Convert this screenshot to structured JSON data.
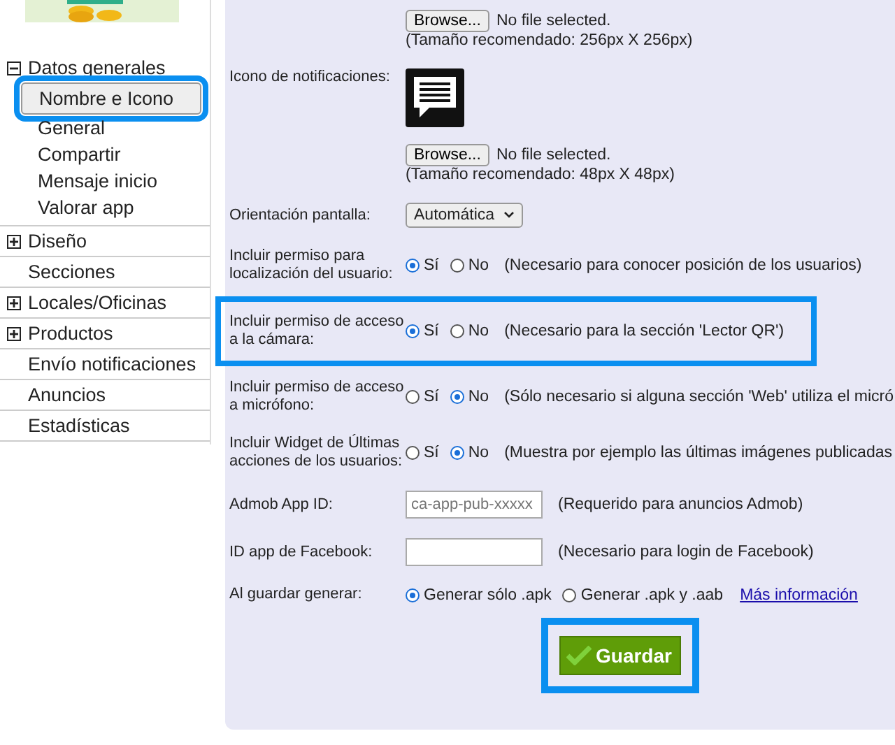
{
  "sidebar": {
    "items": [
      {
        "kind": "group",
        "label": "Datos generales",
        "expanded": true,
        "children": [
          {
            "label": "Nombre e Icono",
            "selected": true,
            "highlighted": true
          },
          {
            "label": "General",
            "selected": false,
            "highlighted": false
          },
          {
            "label": "Compartir",
            "selected": false,
            "highlighted": false
          },
          {
            "label": "Mensaje inicio",
            "selected": false,
            "highlighted": false
          },
          {
            "label": "Valorar app",
            "selected": false,
            "highlighted": false
          }
        ]
      },
      {
        "kind": "group",
        "label": "Diseño",
        "expanded": false
      },
      {
        "kind": "link",
        "label": "Secciones"
      },
      {
        "kind": "group",
        "label": "Locales/Oficinas",
        "expanded": false
      },
      {
        "kind": "group",
        "label": "Productos",
        "expanded": false
      },
      {
        "kind": "link",
        "label": "Envío notificaciones"
      },
      {
        "kind": "link",
        "label": "Anuncios"
      },
      {
        "kind": "link",
        "label": "Estadísticas"
      }
    ]
  },
  "form": {
    "fields": [
      {
        "kind": "upload",
        "preview": false,
        "button": "Browse...",
        "status": "No file selected.",
        "hint": "(Tamaño recomendado: 256px X 256px)",
        "highlighted": false
      },
      {
        "kind": "upload",
        "label": "Icono de notificaciones:",
        "preview": true,
        "button": "Browse...",
        "status": "No file selected.",
        "hint": "(Tamaño recomendado: 48px X 48px)",
        "highlighted": false
      },
      {
        "kind": "select",
        "label": "Orientación pantalla:",
        "value": "Automática",
        "highlighted": false
      },
      {
        "kind": "radio",
        "label": "Incluir permiso para localización del usuario:",
        "options": [
          {
            "label": "Sí",
            "selected": true
          },
          {
            "label": "No",
            "selected": false
          }
        ],
        "note": "(Necesario para conocer posición de los usuarios)",
        "highlighted": false
      },
      {
        "kind": "radio",
        "label": "Incluir permiso de acceso a la cámara:",
        "options": [
          {
            "label": "Sí",
            "selected": true
          },
          {
            "label": "No",
            "selected": false
          }
        ],
        "note": "(Necesario para la sección 'Lector QR')",
        "highlighted": true
      },
      {
        "kind": "radio",
        "label": "Incluir permiso de acceso a micrófono:",
        "options": [
          {
            "label": "Sí",
            "selected": false
          },
          {
            "label": "No",
            "selected": true
          }
        ],
        "note": "(Sólo necesario si alguna sección 'Web' utiliza el micró",
        "highlighted": false
      },
      {
        "kind": "radio",
        "label": "Incluir Widget de Últimas acciones de los usuarios:",
        "options": [
          {
            "label": "Sí",
            "selected": false
          },
          {
            "label": "No",
            "selected": true
          }
        ],
        "note": "(Muestra por ejemplo las últimas imágenes publicadas",
        "highlighted": false
      },
      {
        "kind": "text",
        "label": "Admob App ID:",
        "placeholder": "ca-app-pub-xxxxx",
        "note": "(Requerido para anuncios Admob)",
        "highlighted": false
      },
      {
        "kind": "text",
        "label": "ID app de Facebook:",
        "note": "(Necesario para login de Facebook)",
        "highlighted": false
      },
      {
        "kind": "radio",
        "label": "Al guardar generar:",
        "options": [
          {
            "label": "Generar sólo .apk",
            "selected": true
          },
          {
            "label": "Generar .apk y .aab",
            "selected": false
          }
        ],
        "link": "Más información",
        "highlighted": false
      }
    ],
    "save_button": {
      "label": "Guardar",
      "highlighted": true
    }
  }
}
